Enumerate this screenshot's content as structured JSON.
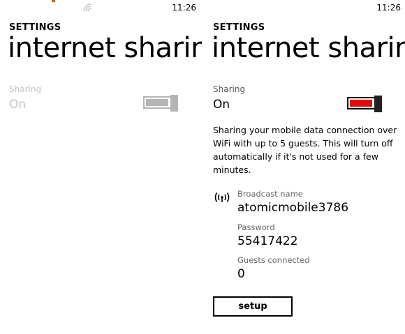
{
  "left_screen": {
    "status_time": "11:26",
    "settings_label": "SETTINGS",
    "title": "internet sharing",
    "sharing_label": "Sharing",
    "sharing_state": "On",
    "toggle_icon": "toggle-switch-icon",
    "signal_icon": "wifi-signal-icon"
  },
  "right_screen": {
    "status_time": "11:26",
    "settings_label": "SETTINGS",
    "title": "internet sharing",
    "sharing_label": "Sharing",
    "sharing_state": "On",
    "toggle_icon": "toggle-switch-icon",
    "toggle_on_color": "#e30909",
    "description": "Sharing your mobile data connection over WiFi with up to 5 guests. This will turn off automatically if it's not used for a few minutes.",
    "broadcast_icon": "broadcast-icon",
    "broadcast_name_label": "Broadcast name",
    "broadcast_name": "atomicmobile3786",
    "password_label": "Password",
    "password": "55417422",
    "guests_label": "Guests connected",
    "guests": "0",
    "setup_label": "setup"
  }
}
